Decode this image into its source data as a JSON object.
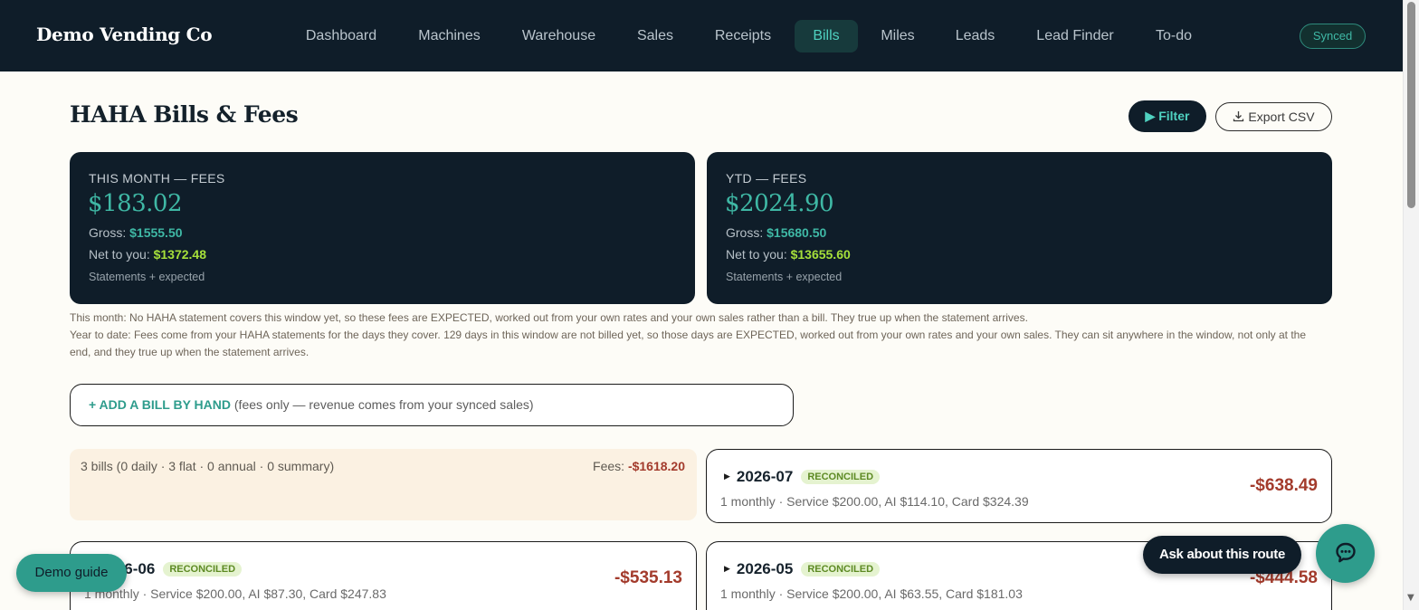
{
  "app": {
    "brand": "Demo Vending Co",
    "sync_status": "Synced"
  },
  "nav": {
    "items": [
      {
        "label": "Dashboard"
      },
      {
        "label": "Machines"
      },
      {
        "label": "Warehouse"
      },
      {
        "label": "Sales"
      },
      {
        "label": "Receipts"
      },
      {
        "label": "Bills",
        "active": true
      },
      {
        "label": "Miles"
      },
      {
        "label": "Leads"
      },
      {
        "label": "Lead Finder"
      },
      {
        "label": "To-do"
      }
    ]
  },
  "page": {
    "title": "HAHA Bills & Fees",
    "filter_label": "▶ Filter",
    "export_label": "Export CSV"
  },
  "cards": {
    "month": {
      "label": "THIS MONTH — FEES",
      "amount": "$183.02",
      "gross_label": "Gross:",
      "gross": "$1555.50",
      "net_label": "Net to you:",
      "net": "$1372.48",
      "note": "Statements + expected"
    },
    "ytd": {
      "label": "YTD — FEES",
      "amount": "$2024.90",
      "gross_label": "Gross:",
      "gross": "$15680.50",
      "net_label": "Net to you:",
      "net": "$13655.60",
      "note": "Statements + expected"
    }
  },
  "explanations": {
    "month": "This month: No HAHA statement covers this window yet, so these fees are EXPECTED, worked out from your own rates and your own sales rather than a bill. They true up when the statement arrives.",
    "ytd": "Year to date: Fees come from your HAHA statements for the days they cover. 129 days in this window are not billed yet, so those days are EXPECTED, worked out from your own rates and your own sales. They can sit anywhere in the window, not only at the end, and they true up when the statement arrives."
  },
  "add_bill": {
    "link": "+ ADD A BILL BY HAND",
    "hint": " (fees only — revenue comes from your synced sales)"
  },
  "summary": {
    "counts": "3 bills (0 daily · 3 flat · 0 annual · 0 summary)",
    "fees_label": "Fees: ",
    "fees_value": "-$1618.20"
  },
  "bills": [
    {
      "month": "2026-07",
      "status": "RECONCILED",
      "amount": "-$638.49",
      "detail": "1 monthly · Service $200.00, AI $114.10, Card $324.39"
    },
    {
      "month": "2026-06",
      "status": "RECONCILED",
      "amount": "-$535.13",
      "detail": "1 monthly · Service $200.00, AI $87.30, Card $247.83"
    },
    {
      "month": "2026-05",
      "status": "RECONCILED",
      "amount": "-$444.58",
      "detail": "1 monthly · Service $200.00, AI $63.55, Card $181.03"
    }
  ],
  "floating": {
    "demo_guide": "Demo guide",
    "ask_route": "Ask about this route",
    "chat_icon": "chat-bubble-icon"
  },
  "colors": {
    "nav_bg": "#0f1d29",
    "accent_teal": "#3fb8a5",
    "net_lime": "#a6e03a",
    "negative_red": "#a33b2c",
    "badge_green": "#e5f3d0",
    "summary_bg": "#fbf1e2",
    "page_bg": "#fdfcf7"
  }
}
